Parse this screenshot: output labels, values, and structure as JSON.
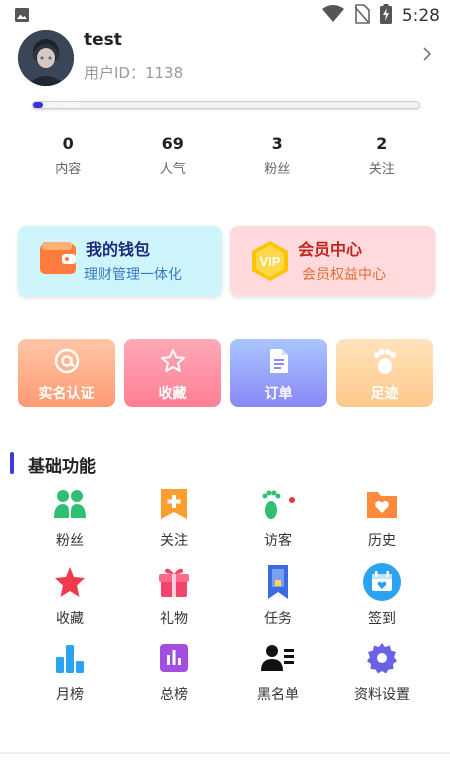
{
  "status_bar": {
    "time": "5:28"
  },
  "profile": {
    "username": "test",
    "user_id": "用户ID：1138"
  },
  "level": {
    "text": "547/1000",
    "progress": 0.025
  },
  "stats": [
    {
      "value": "0",
      "label": "内容"
    },
    {
      "value": "69",
      "label": "人气"
    },
    {
      "value": "3",
      "label": "粉丝"
    },
    {
      "value": "2",
      "label": "关注"
    }
  ],
  "wallet": {
    "title": "我的钱包",
    "subtitle": "理财管理一体化"
  },
  "vip": {
    "title": "会员中心",
    "subtitle": "会员权益中心",
    "badge": "VIP"
  },
  "quick_tiles": [
    {
      "label": "实名认证",
      "icon": "at-icon"
    },
    {
      "label": "收藏",
      "icon": "star-outline-icon"
    },
    {
      "label": "订单",
      "icon": "document-icon"
    },
    {
      "label": "足迹",
      "icon": "footprint-icon"
    }
  ],
  "section": {
    "title": "基础功能"
  },
  "grid": [
    {
      "label": "粉丝",
      "icon": "fans-icon"
    },
    {
      "label": "关注",
      "icon": "follow-icon"
    },
    {
      "label": "访客",
      "icon": "visitor-footprint-icon"
    },
    {
      "label": "历史",
      "icon": "history-folder-icon"
    },
    {
      "label": "收藏",
      "icon": "star-icon"
    },
    {
      "label": "礼物",
      "icon": "gift-icon"
    },
    {
      "label": "任务",
      "icon": "task-bookmark-icon"
    },
    {
      "label": "签到",
      "icon": "calendar-heart-icon"
    },
    {
      "label": "月榜",
      "icon": "bar-chart-icon"
    },
    {
      "label": "总榜",
      "icon": "ranking-icon"
    },
    {
      "label": "黑名单",
      "icon": "blacklist-user-icon"
    },
    {
      "label": "资料设置",
      "icon": "settings-gear-icon"
    }
  ],
  "colors": {
    "accent": "#3d3bd1",
    "wallet_bg": "#cdf5fb",
    "vip_bg": "#ffd9dc",
    "green": "#2fbf71",
    "visitor_dot": "#e53935"
  }
}
